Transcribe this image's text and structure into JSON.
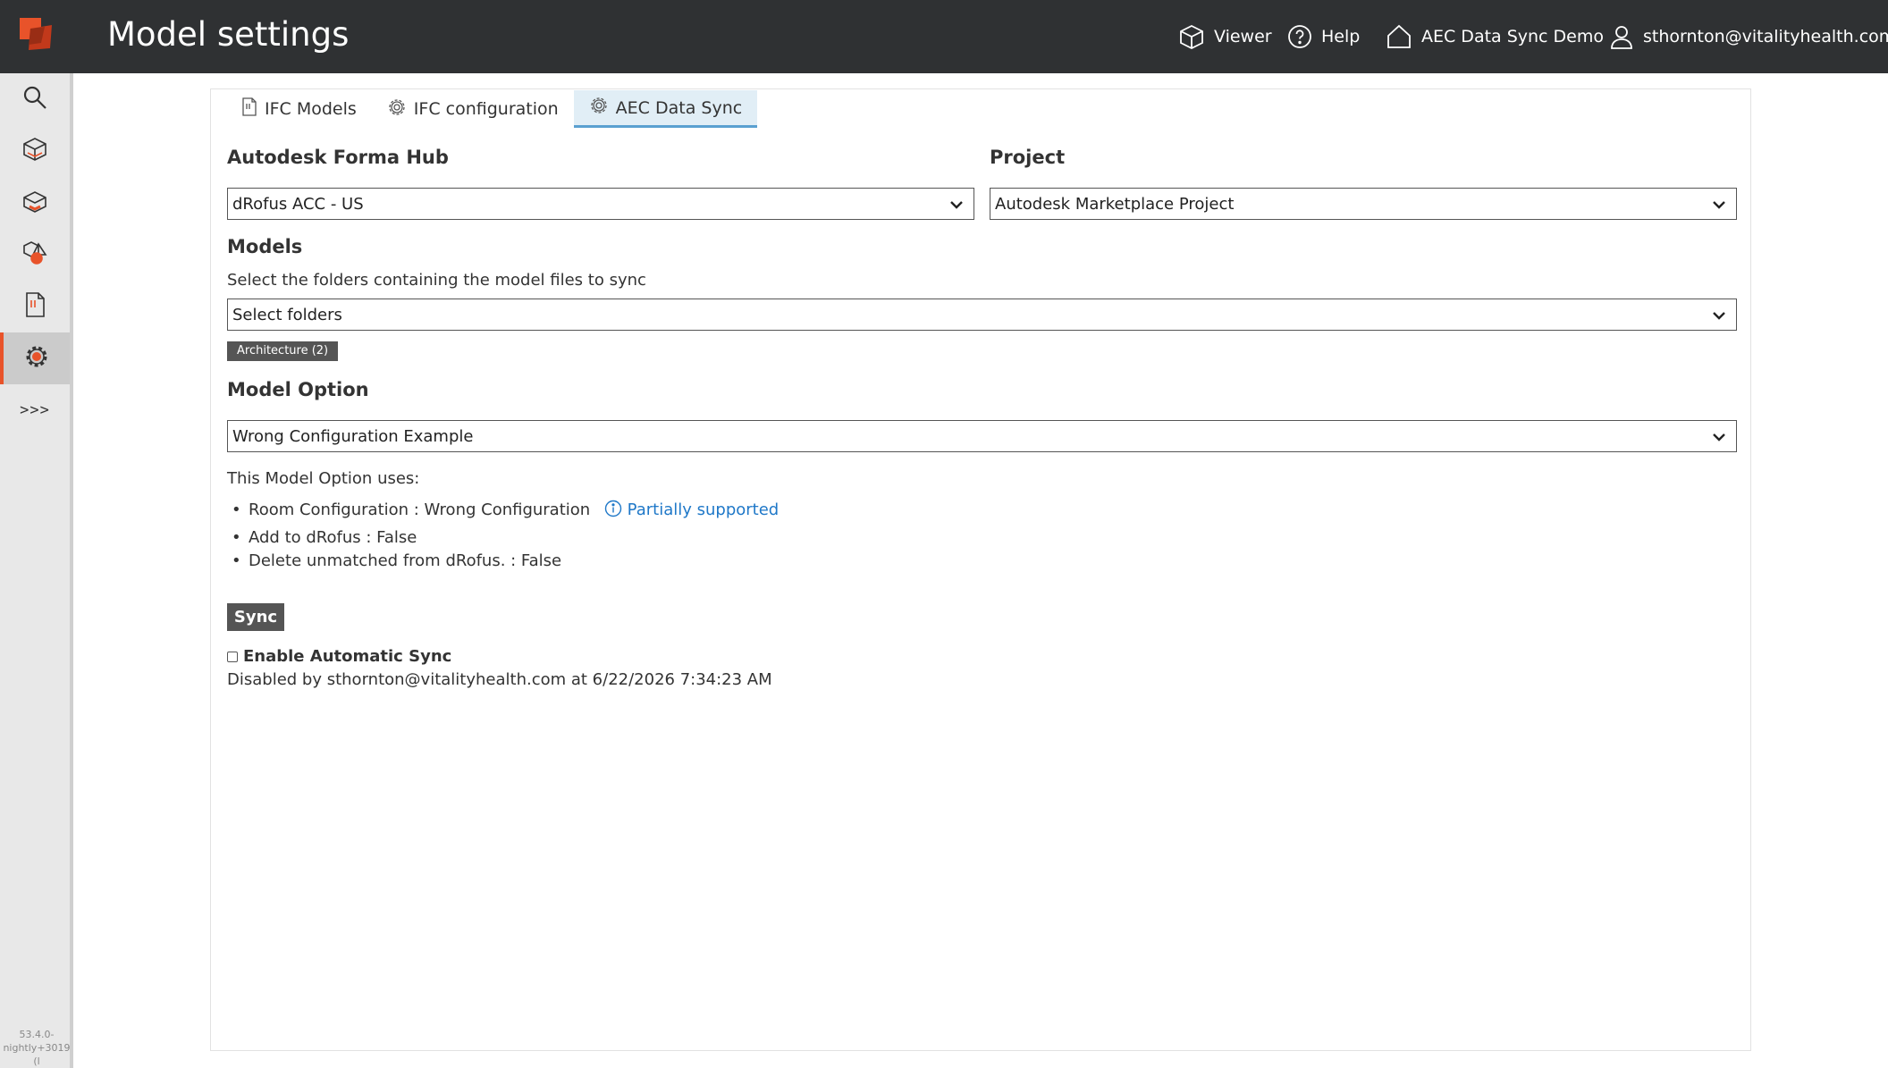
{
  "header": {
    "title": "Model settings",
    "nav": {
      "viewer": "Viewer",
      "help": "Help",
      "project": "AEC Data Sync Demo",
      "user": "sthornton@vitalityhealth.com"
    }
  },
  "sidebar": {
    "items": [
      {
        "icon": "search-icon"
      },
      {
        "icon": "model-icon"
      },
      {
        "icon": "model-edit-icon"
      },
      {
        "icon": "shapes-icon"
      },
      {
        "icon": "ifc-file-icon"
      },
      {
        "icon": "settings-gear-icon",
        "active": true
      }
    ],
    "more": ">>>",
    "version_line1": "53.4.0-",
    "version_line2": "nightly+3019 (l"
  },
  "tabs": [
    {
      "label": "IFC Models",
      "icon": "ifc-file-icon"
    },
    {
      "label": "IFC configuration",
      "icon": "gear-icon"
    },
    {
      "label": "AEC Data Sync",
      "icon": "gear-icon",
      "active": true
    }
  ],
  "form": {
    "hub_label": "Autodesk Forma Hub",
    "hub_value": "dRofus ACC - US",
    "project_label": "Project",
    "project_value": "Autodesk Marketplace Project",
    "models_label": "Models",
    "models_help": "Select the folders containing the model files to sync",
    "folders_placeholder": "Select folders",
    "folder_chip": "Architecture (2)",
    "model_option_label": "Model Option",
    "model_option_value": "Wrong Configuration Example",
    "uses_intro": "This Model Option uses:",
    "uses": {
      "room_config": "Room Configuration : Wrong Configuration",
      "partial_label": "Partially supported",
      "add": "Add to dRofus : False",
      "delete": "Delete unmatched from dRofus. : False"
    },
    "sync_label": "Sync",
    "auto_sync_label": "Enable Automatic Sync",
    "auto_sync_checked": false,
    "status": "Disabled by sthornton@vitalityhealth.com at 6/22/2026 7:34:23 AM"
  },
  "colors": {
    "header_bg": "#2f3133",
    "accent": "#e8532a",
    "link": "#1f78c8",
    "active_tab_bg": "#e1eef6"
  }
}
